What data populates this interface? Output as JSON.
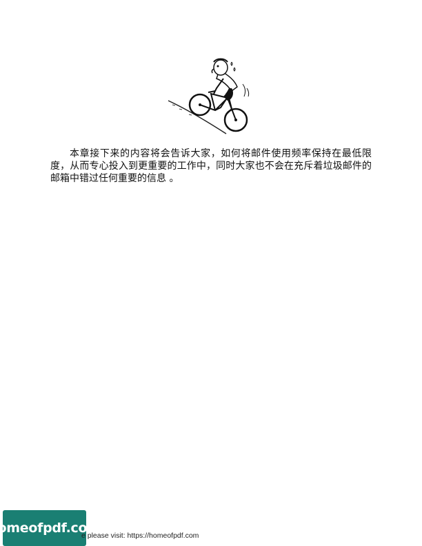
{
  "illustration": {
    "icon": "cyclist-uphill-illustration"
  },
  "body": {
    "paragraph": "本章接下来的内容将会告诉大家，如何将邮件使用频率保持在最低限度，从而专心投入到更重要的工作中，同时大家也不会在充斥着垃圾邮件的邮箱中错过任何重要的信息 。"
  },
  "footer": {
    "logo_text": "homeofpdf.com",
    "text": "e please visit: https://homeofpdf.com"
  },
  "colors": {
    "logo_bg": "#1a7f73",
    "text": "#111111"
  }
}
